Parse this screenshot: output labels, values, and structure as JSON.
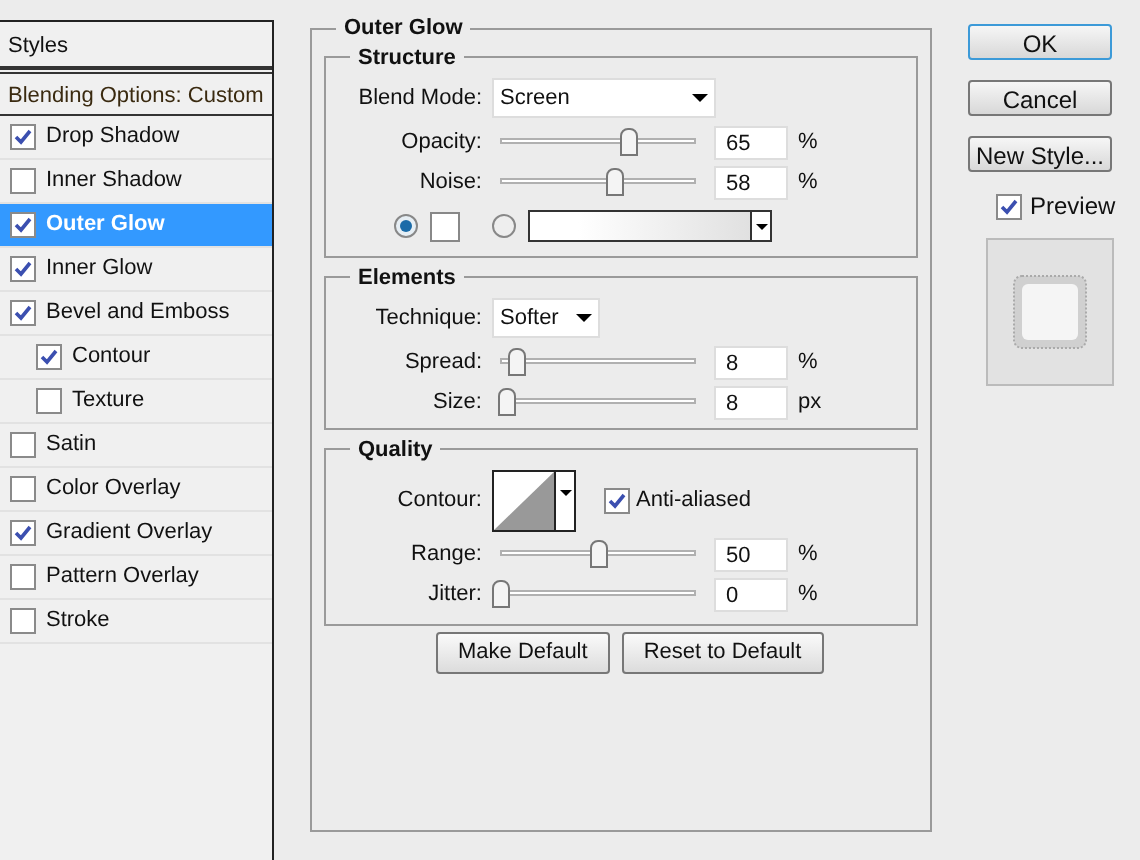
{
  "styles_panel": {
    "title": "Styles",
    "blending_options": "Blending Options: Custom",
    "items": [
      {
        "label": "Drop Shadow",
        "checked": true,
        "selected": false
      },
      {
        "label": "Inner Shadow",
        "checked": false,
        "selected": false
      },
      {
        "label": "Outer Glow",
        "checked": true,
        "selected": true
      },
      {
        "label": "Inner Glow",
        "checked": true,
        "selected": false
      },
      {
        "label": "Bevel and Emboss",
        "checked": true,
        "selected": false,
        "children": [
          {
            "label": "Contour",
            "checked": true,
            "selected": false
          },
          {
            "label": "Texture",
            "checked": false,
            "selected": false
          }
        ]
      },
      {
        "label": "Satin",
        "checked": false,
        "selected": false
      },
      {
        "label": "Color Overlay",
        "checked": false,
        "selected": false
      },
      {
        "label": "Gradient Overlay",
        "checked": true,
        "selected": false
      },
      {
        "label": "Pattern Overlay",
        "checked": false,
        "selected": false
      },
      {
        "label": "Stroke",
        "checked": false,
        "selected": false
      }
    ]
  },
  "outer_glow": {
    "title": "Outer Glow",
    "structure": {
      "title": "Structure",
      "blend_mode": {
        "label": "Blend Mode:",
        "value": "Screen"
      },
      "sliders": [
        {
          "label": "Opacity:",
          "level": 0.65,
          "value": "65",
          "unit": "%"
        },
        {
          "label": "Noise:",
          "level": 0.58,
          "value": "58",
          "unit": "%"
        }
      ],
      "fill_options": [
        {
          "kind": "color",
          "selected": true
        },
        {
          "kind": "gradient",
          "selected": false
        }
      ]
    },
    "elements": {
      "title": "Elements",
      "technique": {
        "label": "Technique:",
        "value": "Softer"
      },
      "sliders": [
        {
          "label": "Spread:",
          "level": 0.08,
          "value": "8",
          "unit": "%"
        },
        {
          "label": "Size:",
          "level": 0.03,
          "value": "8",
          "unit": "px"
        }
      ]
    },
    "quality": {
      "title": "Quality",
      "contour_label": "Contour:",
      "anti_aliased": {
        "label": "Anti-aliased",
        "checked": true
      },
      "sliders": [
        {
          "label": "Range:",
          "level": 0.5,
          "value": "50",
          "unit": "%"
        },
        {
          "label": "Jitter:",
          "level": 0,
          "value": "0",
          "unit": "%"
        }
      ]
    },
    "buttons": [
      "Make Default",
      "Reset to Default"
    ]
  },
  "dialog_buttons": [
    {
      "label": "OK",
      "default": true
    },
    {
      "label": "Cancel",
      "default": false
    },
    {
      "label": "New Style...",
      "default": false
    }
  ],
  "preview": {
    "label": "Preview",
    "checked": true
  }
}
